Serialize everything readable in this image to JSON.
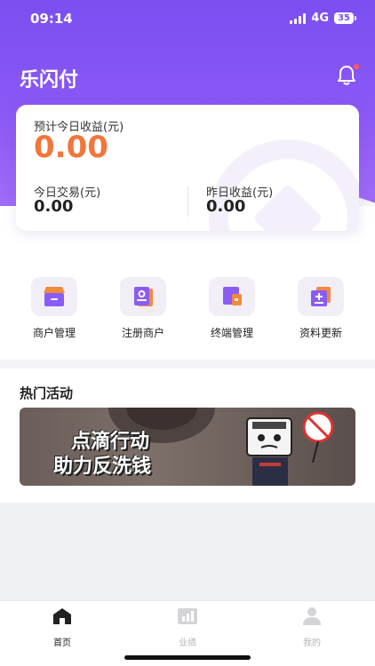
{
  "status_bar": {
    "time": "09:14",
    "network": "4G",
    "battery": "35"
  },
  "header": {
    "title": "乐闪付",
    "notification_icon": "bell-icon"
  },
  "earnings": {
    "today_label": "预计今日收益(元)",
    "today_value": "0.00",
    "trade_label": "今日交易(元)",
    "trade_value": "0.00",
    "yesterday_label": "昨日收益(元)",
    "yesterday_value": "0.00"
  },
  "grid": [
    {
      "label": "商户管理",
      "icon": "shop-icon"
    },
    {
      "label": "注册商户",
      "icon": "register-icon"
    },
    {
      "label": "终端管理",
      "icon": "terminal-icon"
    },
    {
      "label": "资料更新",
      "icon": "update-icon"
    }
  ],
  "hot": {
    "title": "热门活动",
    "banner_line1": "点滴行动",
    "banner_line2": "助力反洗钱"
  },
  "tabs": [
    {
      "label": "首页",
      "icon": "home-icon",
      "active": true
    },
    {
      "label": "业绩",
      "icon": "chart-icon",
      "active": false
    },
    {
      "label": "我的",
      "icon": "user-icon",
      "active": false
    }
  ],
  "colors": {
    "primary": "#7b4ff0",
    "accent": "#f2763a",
    "inactive": "#c4c4c8"
  }
}
